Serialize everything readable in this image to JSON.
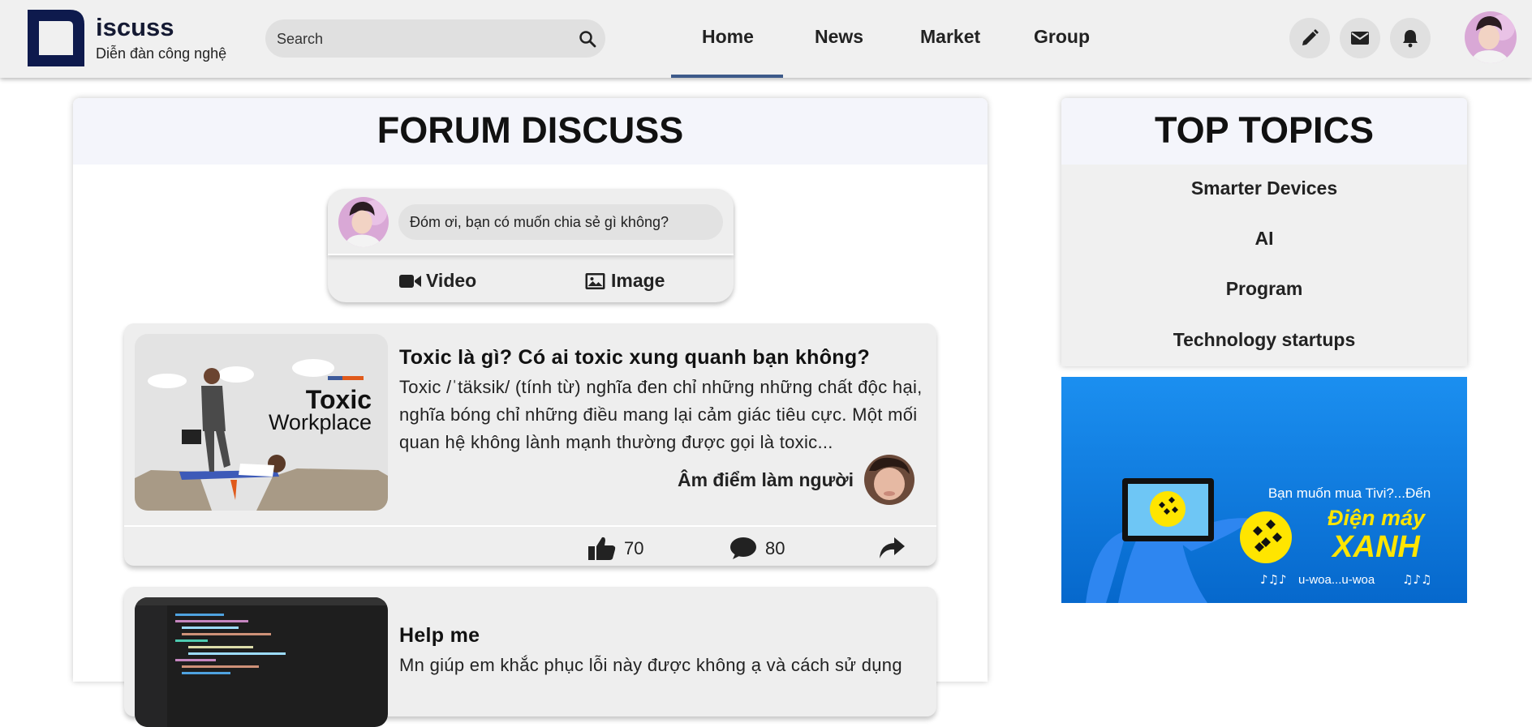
{
  "header": {
    "logo_title": "iscuss",
    "logo_subtitle": "Diễn đàn công nghệ",
    "search_placeholder": "Search",
    "nav": [
      {
        "label": "Home",
        "active": true
      },
      {
        "label": "News",
        "active": false
      },
      {
        "label": "Market",
        "active": false
      },
      {
        "label": "Group",
        "active": false
      }
    ],
    "actions": [
      "pencil-icon",
      "envelope-icon",
      "bell-icon"
    ],
    "accent_color": "#3d5a8a",
    "brand_color": "#151a33"
  },
  "forum": {
    "title": "FORUM DISCUSS",
    "composer": {
      "placeholder": "Đóm ơi, bạn có muốn chia sẻ gì không?",
      "video_label": "Video",
      "image_label": "Image"
    },
    "posts": [
      {
        "thumbnail_text_1": "Toxic",
        "thumbnail_text_2": "Workplace",
        "title": "Toxic là gì? Có ai toxic xung quanh bạn không?",
        "body": "Toxic /ˈtäksik/ (tính từ) nghĩa đen chỉ những những chất độc hại, nghĩa bóng chỉ những điều mang lại cảm giác tiêu cực. Một mối quan hệ không lành mạnh thường được gọi là toxic...",
        "author": "Âm điểm làm người",
        "likes": "70",
        "comments": "80"
      },
      {
        "title": "Help me",
        "body": "Mn giúp em khắc phục lỗi này được không ạ và cách sử dụng"
      }
    ]
  },
  "top_topics": {
    "title": "TOP TOPICS",
    "items": [
      "Smarter Devices",
      "AI",
      "Program",
      "Technology startups"
    ]
  },
  "ad": {
    "tagline": "Bạn muốn mua Tivi?...Đến",
    "brand_line_1": "Điện máy",
    "brand_line_2": "XANH",
    "jingle": "u-woa...u-woa",
    "bg_color": "#0a7fe0",
    "brand_color": "#ffe500"
  }
}
